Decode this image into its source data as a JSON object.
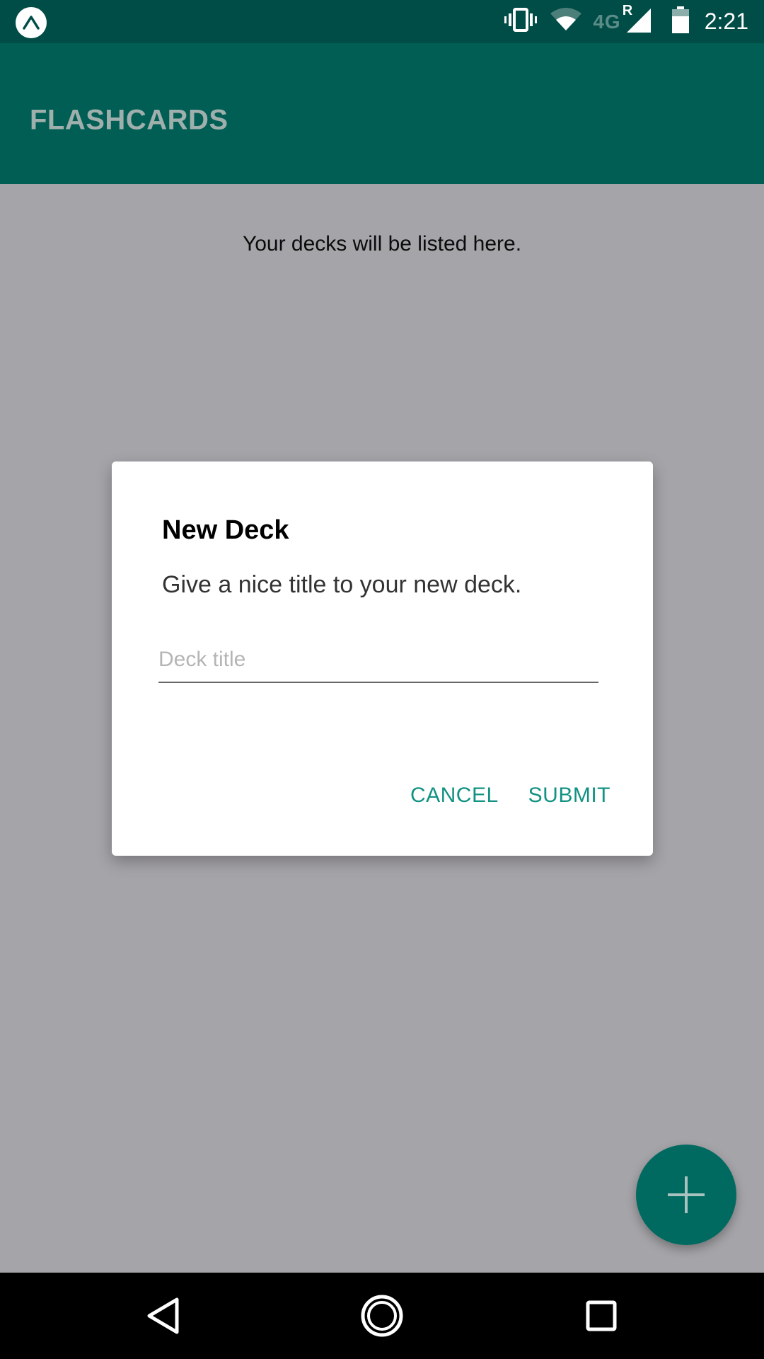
{
  "status_bar": {
    "network_label": "4G",
    "roaming_label": "R",
    "time": "2:21",
    "icons": [
      "expo-icon",
      "vibrate-icon",
      "wifi-icon",
      "signal-icon",
      "battery-icon"
    ]
  },
  "app_bar": {
    "title": "FLASHCARDS"
  },
  "content": {
    "empty_text": "Your decks will be listed here."
  },
  "dialog": {
    "title": "New Deck",
    "message": "Give a nice title to your new deck.",
    "input_value": "",
    "input_placeholder": "Deck title",
    "cancel_label": "CANCEL",
    "submit_label": "SUBMIT"
  },
  "fab": {
    "icon": "plus-icon"
  },
  "nav_bar": {
    "icons": [
      "back-icon",
      "home-icon",
      "recents-icon"
    ]
  },
  "colors": {
    "status_bar": "#004c46",
    "app_bar": "#005e55",
    "accent": "#129282",
    "fab": "#006a60",
    "scrim": "#a5a4a8"
  }
}
